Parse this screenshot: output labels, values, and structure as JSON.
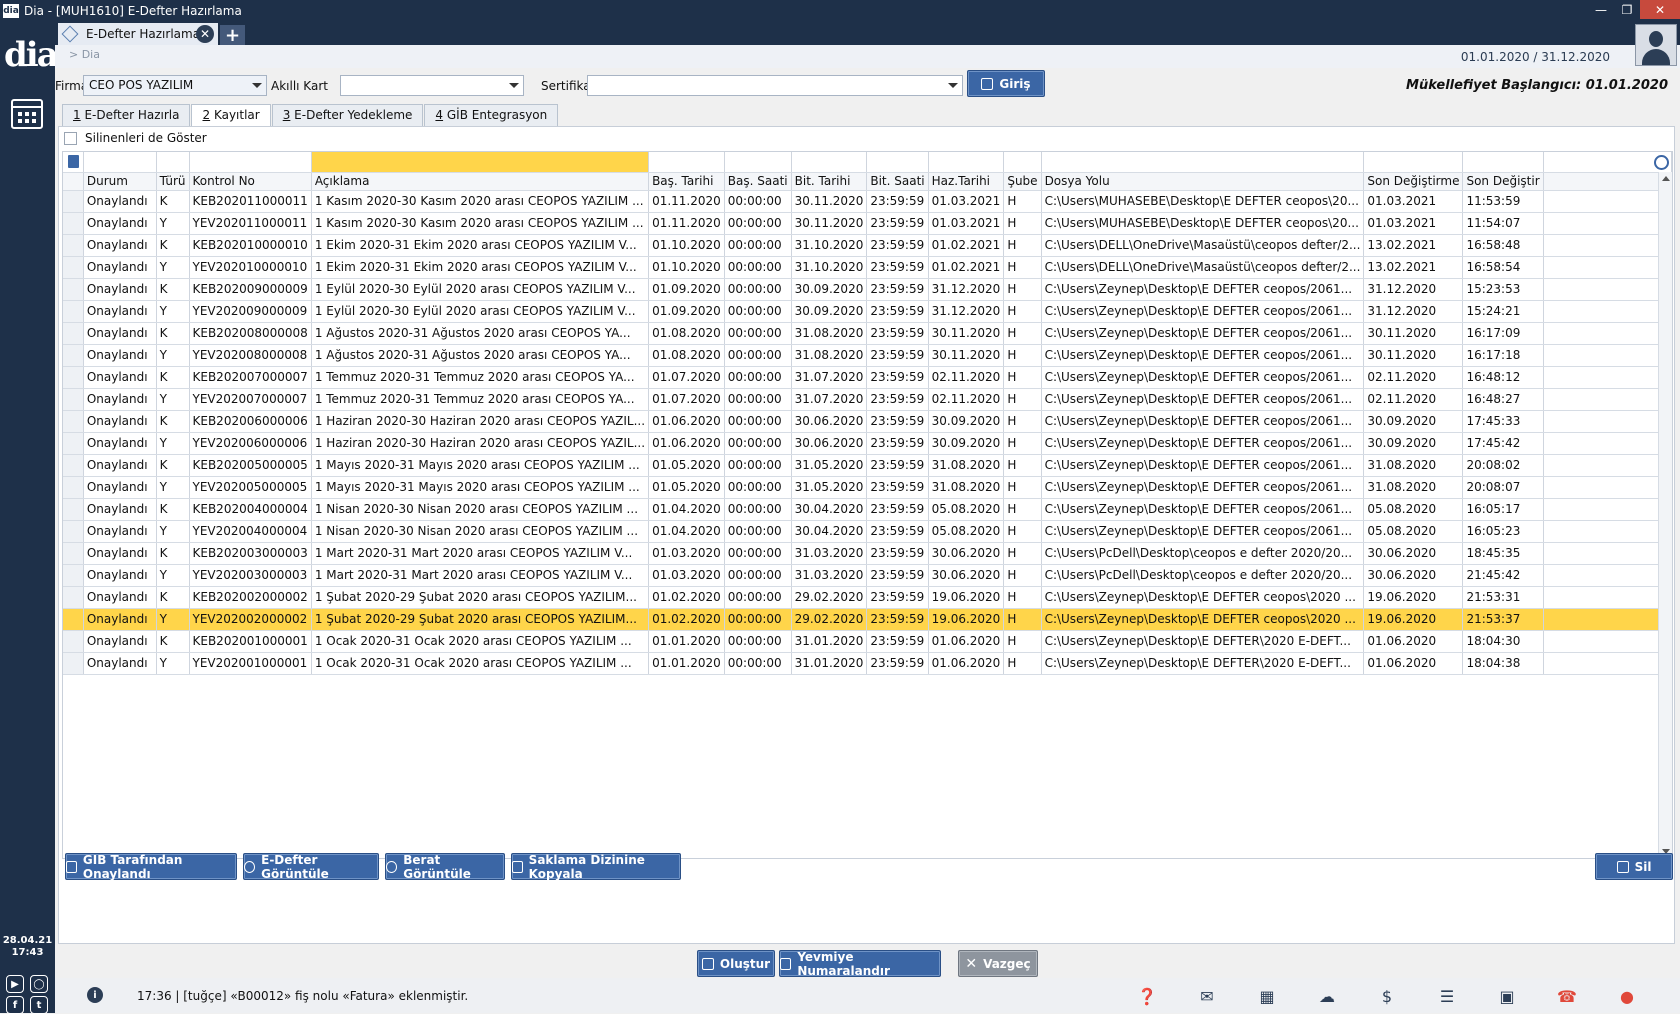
{
  "window": {
    "title": "Dia - [MUH1610] E-Defter Hazırlama",
    "app_badge": "dia"
  },
  "leftbar": {
    "logo": "dia",
    "date": "28.04.21",
    "time": "17:43"
  },
  "tabs": {
    "doc_tab_label": "E-Defter Hazırlama",
    "close_glyph": "✕",
    "add_glyph": "+"
  },
  "header": {
    "breadcrumb": "> Dia",
    "period": "01.01.2020 / 31.12.2020"
  },
  "filters": {
    "firma_label": "Firma",
    "firma_value": "CEO POS YAZILIM",
    "akilli_label": "Akıllı Kart",
    "akilli_value": "",
    "sertifika_label": "Sertifika",
    "sertifika_value": "",
    "giris_label": "Giriş",
    "obligation": "Mükellefiyet Başlangıcı: 01.01.2020"
  },
  "subtabs": [
    {
      "key": "1",
      "label": " E-Defter Hazırla"
    },
    {
      "key": "2",
      "label": " Kayıtlar"
    },
    {
      "key": "3",
      "label": " E-Defter Yedekleme"
    },
    {
      "key": "4",
      "label": " GİB Entegrasyon"
    }
  ],
  "show_deleted_label": "Silinenleri de Göster",
  "grid": {
    "columns": [
      "Durum",
      "Türü",
      "Kontrol No",
      "Açıklama",
      "Baş. Tarihi",
      "Baş. Saati",
      "Bit. Tarihi",
      "Bit. Saati",
      "Haz.Tarihi",
      "Şube",
      "Dosya Yolu",
      "Son Değiştirme",
      "Son Değiştir"
    ],
    "rows": [
      [
        "Onaylandı",
        "K",
        "KEB202011000011",
        "1 Kasım 2020-30 Kasım 2020 arası CEOPOS YAZILIM ...",
        "01.11.2020",
        "00:00:00",
        "30.11.2020",
        "23:59:59",
        "01.03.2021",
        "H",
        "C:\\Users\\MUHASEBE\\Desktop\\E DEFTER ceopos\\20...",
        "01.03.2021",
        "11:53:59"
      ],
      [
        "Onaylandı",
        "Y",
        "YEV202011000011",
        "1 Kasım 2020-30 Kasım 2020 arası CEOPOS YAZILIM ...",
        "01.11.2020",
        "00:00:00",
        "30.11.2020",
        "23:59:59",
        "01.03.2021",
        "H",
        "C:\\Users\\MUHASEBE\\Desktop\\E DEFTER ceopos\\20...",
        "01.03.2021",
        "11:54:07"
      ],
      [
        "Onaylandı",
        "K",
        "KEB202010000010",
        "1 Ekim 2020-31 Ekim 2020 arası CEOPOS YAZILIM V...",
        "01.10.2020",
        "00:00:00",
        "31.10.2020",
        "23:59:59",
        "01.02.2021",
        "H",
        "C:\\Users\\DELL\\OneDrive\\Masaüstü\\ceopos defter/2...",
        "13.02.2021",
        "16:58:48"
      ],
      [
        "Onaylandı",
        "Y",
        "YEV202010000010",
        "1 Ekim 2020-31 Ekim 2020 arası CEOPOS YAZILIM V...",
        "01.10.2020",
        "00:00:00",
        "31.10.2020",
        "23:59:59",
        "01.02.2021",
        "H",
        "C:\\Users\\DELL\\OneDrive\\Masaüstü\\ceopos defter/2...",
        "13.02.2021",
        "16:58:54"
      ],
      [
        "Onaylandı",
        "K",
        "KEB202009000009",
        "1 Eylül 2020-30 Eylül 2020 arası CEOPOS YAZILIM V...",
        "01.09.2020",
        "00:00:00",
        "30.09.2020",
        "23:59:59",
        "31.12.2020",
        "H",
        "C:\\Users\\Zeynep\\Desktop\\E DEFTER ceopos/2061...",
        "31.12.2020",
        "15:23:53"
      ],
      [
        "Onaylandı",
        "Y",
        "YEV202009000009",
        "1 Eylül 2020-30 Eylül 2020 arası CEOPOS YAZILIM V...",
        "01.09.2020",
        "00:00:00",
        "30.09.2020",
        "23:59:59",
        "31.12.2020",
        "H",
        "C:\\Users\\Zeynep\\Desktop\\E DEFTER ceopos/2061...",
        "31.12.2020",
        "15:24:21"
      ],
      [
        "Onaylandı",
        "K",
        "KEB202008000008",
        "1 Ağustos 2020-31 Ağustos 2020 arası CEOPOS YA...",
        "01.08.2020",
        "00:00:00",
        "31.08.2020",
        "23:59:59",
        "30.11.2020",
        "H",
        "C:\\Users\\Zeynep\\Desktop\\E DEFTER ceopos/2061...",
        "30.11.2020",
        "16:17:09"
      ],
      [
        "Onaylandı",
        "Y",
        "YEV202008000008",
        "1 Ağustos 2020-31 Ağustos 2020 arası CEOPOS YA...",
        "01.08.2020",
        "00:00:00",
        "31.08.2020",
        "23:59:59",
        "30.11.2020",
        "H",
        "C:\\Users\\Zeynep\\Desktop\\E DEFTER ceopos/2061...",
        "30.11.2020",
        "16:17:18"
      ],
      [
        "Onaylandı",
        "K",
        "KEB202007000007",
        "1 Temmuz 2020-31 Temmuz 2020 arası CEOPOS YA...",
        "01.07.2020",
        "00:00:00",
        "31.07.2020",
        "23:59:59",
        "02.11.2020",
        "H",
        "C:\\Users\\Zeynep\\Desktop\\E DEFTER ceopos/2061...",
        "02.11.2020",
        "16:48:12"
      ],
      [
        "Onaylandı",
        "Y",
        "YEV202007000007",
        "1 Temmuz 2020-31 Temmuz 2020 arası CEOPOS YA...",
        "01.07.2020",
        "00:00:00",
        "31.07.2020",
        "23:59:59",
        "02.11.2020",
        "H",
        "C:\\Users\\Zeynep\\Desktop\\E DEFTER ceopos/2061...",
        "02.11.2020",
        "16:48:27"
      ],
      [
        "Onaylandı",
        "K",
        "KEB202006000006",
        "1 Haziran 2020-30 Haziran 2020 arası CEOPOS YAZIL...",
        "01.06.2020",
        "00:00:00",
        "30.06.2020",
        "23:59:59",
        "30.09.2020",
        "H",
        "C:\\Users\\Zeynep\\Desktop\\E DEFTER ceopos/2061...",
        "30.09.2020",
        "17:45:33"
      ],
      [
        "Onaylandı",
        "Y",
        "YEV202006000006",
        "1 Haziran 2020-30 Haziran 2020 arası CEOPOS YAZIL...",
        "01.06.2020",
        "00:00:00",
        "30.06.2020",
        "23:59:59",
        "30.09.2020",
        "H",
        "C:\\Users\\Zeynep\\Desktop\\E DEFTER ceopos/2061...",
        "30.09.2020",
        "17:45:42"
      ],
      [
        "Onaylandı",
        "K",
        "KEB202005000005",
        "1 Mayıs 2020-31 Mayıs 2020 arası CEOPOS YAZILIM ...",
        "01.05.2020",
        "00:00:00",
        "31.05.2020",
        "23:59:59",
        "31.08.2020",
        "H",
        "C:\\Users\\Zeynep\\Desktop\\E DEFTER ceopos/2061...",
        "31.08.2020",
        "20:08:02"
      ],
      [
        "Onaylandı",
        "Y",
        "YEV202005000005",
        "1 Mayıs 2020-31 Mayıs 2020 arası CEOPOS YAZILIM ...",
        "01.05.2020",
        "00:00:00",
        "31.05.2020",
        "23:59:59",
        "31.08.2020",
        "H",
        "C:\\Users\\Zeynep\\Desktop\\E DEFTER ceopos/2061...",
        "31.08.2020",
        "20:08:07"
      ],
      [
        "Onaylandı",
        "K",
        "KEB202004000004",
        "1 Nisan 2020-30 Nisan 2020 arası CEOPOS YAZILIM ...",
        "01.04.2020",
        "00:00:00",
        "30.04.2020",
        "23:59:59",
        "05.08.2020",
        "H",
        "C:\\Users\\Zeynep\\Desktop\\E DEFTER ceopos/2061...",
        "05.08.2020",
        "16:05:17"
      ],
      [
        "Onaylandı",
        "Y",
        "YEV202004000004",
        "1 Nisan 2020-30 Nisan 2020 arası CEOPOS YAZILIM ...",
        "01.04.2020",
        "00:00:00",
        "30.04.2020",
        "23:59:59",
        "05.08.2020",
        "H",
        "C:\\Users\\Zeynep\\Desktop\\E DEFTER ceopos/2061...",
        "05.08.2020",
        "16:05:23"
      ],
      [
        "Onaylandı",
        "K",
        "KEB202003000003",
        "1 Mart 2020-31 Mart 2020 arası CEOPOS YAZILIM V...",
        "01.03.2020",
        "00:00:00",
        "31.03.2020",
        "23:59:59",
        "30.06.2020",
        "H",
        "C:\\Users\\PcDell\\Desktop\\ceopos e defter 2020/20...",
        "30.06.2020",
        "18:45:35"
      ],
      [
        "Onaylandı",
        "Y",
        "YEV202003000003",
        "1 Mart 2020-31 Mart 2020 arası CEOPOS YAZILIM V...",
        "01.03.2020",
        "00:00:00",
        "31.03.2020",
        "23:59:59",
        "30.06.2020",
        "H",
        "C:\\Users\\PcDell\\Desktop\\ceopos e defter 2020/20...",
        "30.06.2020",
        "21:45:42"
      ],
      [
        "Onaylandı",
        "K",
        "KEB202002000002",
        "1 Şubat 2020-29 Şubat 2020 arası CEOPOS YAZILIM...",
        "01.02.2020",
        "00:00:00",
        "29.02.2020",
        "23:59:59",
        "19.06.2020",
        "H",
        "C:\\Users\\Zeynep\\Desktop\\E DEFTER ceopos\\2020 ...",
        "19.06.2020",
        "21:53:31"
      ],
      [
        "Onaylandı",
        "Y",
        "YEV202002000002",
        "1 Şubat 2020-29 Şubat 2020 arası CEOPOS YAZILIM...",
        "01.02.2020",
        "00:00:00",
        "29.02.2020",
        "23:59:59",
        "19.06.2020",
        "H",
        "C:\\Users\\Zeynep\\Desktop\\E DEFTER ceopos\\2020 ...",
        "19.06.2020",
        "21:53:37"
      ],
      [
        "Onaylandı",
        "K",
        "KEB202001000001",
        "1 Ocak 2020-31 Ocak 2020 arası CEOPOS YAZILIM ...",
        "01.01.2020",
        "00:00:00",
        "31.01.2020",
        "23:59:59",
        "01.06.2020",
        "H",
        "C:\\Users\\Zeynep\\Desktop\\E DEFTER\\2020 E-DEFT...",
        "01.06.2020",
        "18:04:30"
      ],
      [
        "Onaylandı",
        "Y",
        "YEV202001000001",
        "1 Ocak 2020-31 Ocak 2020 arası CEOPOS YAZILIM ...",
        "01.01.2020",
        "00:00:00",
        "31.01.2020",
        "23:59:59",
        "01.06.2020",
        "H",
        "C:\\Users\\Zeynep\\Desktop\\E DEFTER\\2020 E-DEFT...",
        "01.06.2020",
        "18:04:38"
      ]
    ],
    "selected_row": 19
  },
  "bottom_buttons": {
    "gib": "GIB Tarafından Onaylandı",
    "edefter": "E-Defter Görüntüle",
    "berat": "Berat Görüntüle",
    "saklama": "Saklama Dizinine Kopyala",
    "sil": "Sil"
  },
  "actions": {
    "olustur": "Oluştur",
    "yevmiye": "Yevmiye Numaralandır",
    "vazgec": "Vazgeç"
  },
  "status": {
    "info_glyph": "i",
    "text": "17:36 | [tuğçe] «B00012» fiş nolu «Fatura» eklenmiştir."
  },
  "colors": {
    "navy": "#1e3049",
    "button_blue": "#3b66a5",
    "highlight": "#ffd54a",
    "disabled_gray": "#8e959e"
  }
}
